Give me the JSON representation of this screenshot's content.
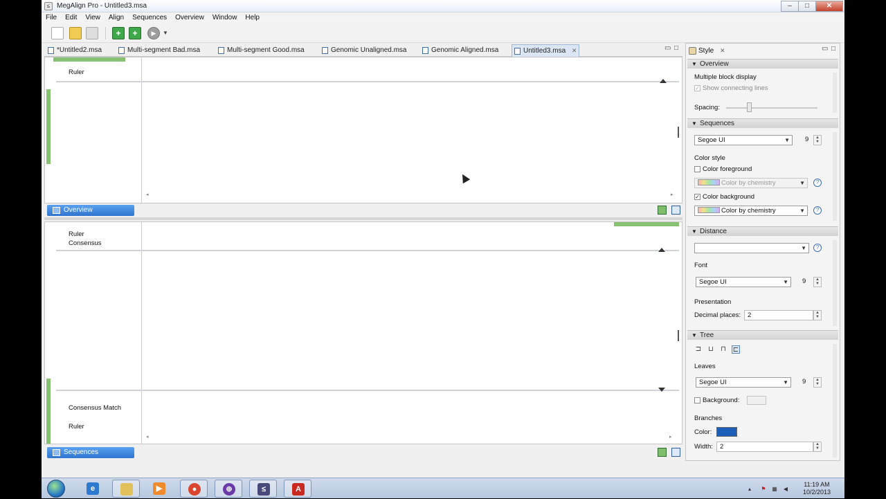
{
  "window": {
    "title": "MegAlign Pro - Untitled3.msa"
  },
  "menu": [
    "File",
    "Edit",
    "View",
    "Align",
    "Sequences",
    "Overview",
    "Window",
    "Help"
  ],
  "toolbar": {
    "seq_label": "+",
    "seq2_label": "+",
    "run_label": "▶"
  },
  "tabs": [
    {
      "label": "*Untitled2.msa"
    },
    {
      "label": "Multi-segment Bad.msa"
    },
    {
      "label": "Multi-segment Good.msa"
    },
    {
      "label": "Genomic Unaligned.msa"
    },
    {
      "label": "Genomic Aligned.msa"
    },
    {
      "label": "Untitled3.msa",
      "active": true
    }
  ],
  "overview_pane": {
    "labels": {
      "ruler": "Ruler"
    },
    "tab_label": "Overview"
  },
  "sequences_pane": {
    "top_labels": {
      "ruler": "Ruler",
      "consensus": "Consensus"
    },
    "bottom_labels": {
      "consensus_match": "Consensus Match",
      "ruler": "Ruler"
    },
    "tab_label": "Sequences"
  },
  "style_panel": {
    "tab_label": "Style",
    "overview": {
      "header": "Overview",
      "multiple_block": "Multiple block display",
      "show_connecting": "Show connecting lines",
      "show_connecting_checked": true,
      "spacing_label": "Spacing:"
    },
    "sequences": {
      "header": "Sequences",
      "font": "Segoe UI",
      "size": "9",
      "color_style": "Color style",
      "color_fg_label": "Color foreground",
      "color_fg_checked": false,
      "color_fg_value": "Color by chemistry",
      "color_bg_label": "Color background",
      "color_bg_checked": true,
      "color_bg_value": "Color by chemistry"
    },
    "distance": {
      "header": "Distance",
      "selection": "",
      "font_label": "Font",
      "font": "Segoe UI",
      "size": "9",
      "presentation": "Presentation",
      "decimal_label": "Decimal places:",
      "decimal_value": "2"
    },
    "tree": {
      "header": "Tree",
      "leaves_label": "Leaves",
      "font": "Segoe UI",
      "size": "9",
      "background_label": "Background:",
      "background_checked": false,
      "branches_label": "Branches",
      "color_label": "Color:",
      "branch_color": "#1d5fb8",
      "width_label": "Width:",
      "width_value": "2"
    }
  },
  "taskbar": {
    "items": [
      "ie-icon",
      "folder-icon",
      "media-icon",
      "chrome-icon",
      "megalign-icon",
      "vs-icon",
      "pdf-icon"
    ],
    "clock_time": "11:19 AM",
    "clock_date": "10/2/2013"
  }
}
